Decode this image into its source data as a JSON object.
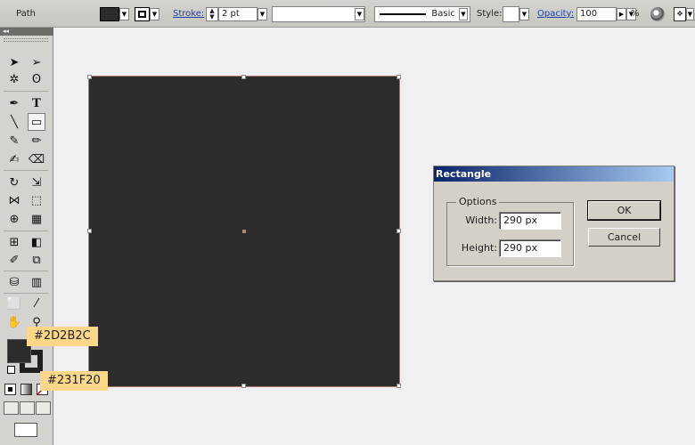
{
  "control_bar": {
    "selection_label": "Path",
    "stroke_label": "Stroke:",
    "stroke_weight": "2 pt",
    "profile_label": "Basic",
    "style_label": "Style:",
    "opacity_label": "Opacity:",
    "opacity_value": "100",
    "opacity_unit": "%"
  },
  "swatches": {
    "fill_color": "#2D2B2C",
    "stroke_color": "#231F20"
  },
  "callouts": {
    "fill": "#2D2B2C",
    "stroke": "#231F20"
  },
  "artwork": {
    "fill": "#2D2B2C"
  },
  "dialog": {
    "title": "Rectangle",
    "group_label": "Options",
    "width_label": "Width:",
    "width_value": "290 px",
    "height_label": "Height:",
    "height_value": "290 px",
    "ok_label": "OK",
    "cancel_label": "Cancel"
  },
  "tools": [
    "selection-tool",
    "direct-selection-tool",
    "magic-wand-tool",
    "lasso-tool",
    "pen-tool",
    "type-tool",
    "line-segment-tool",
    "rectangle-tool",
    "paintbrush-tool",
    "pencil-tool",
    "blob-brush-tool",
    "eraser-tool",
    "rotate-tool",
    "scale-tool",
    "width-tool",
    "free-transform-tool",
    "shape-builder-tool",
    "perspective-grid-tool",
    "mesh-tool",
    "gradient-tool",
    "eyedropper-tool",
    "blend-tool",
    "symbol-sprayer-tool",
    "column-graph-tool",
    "artboard-tool",
    "slice-tool",
    "hand-tool",
    "zoom-tool"
  ]
}
